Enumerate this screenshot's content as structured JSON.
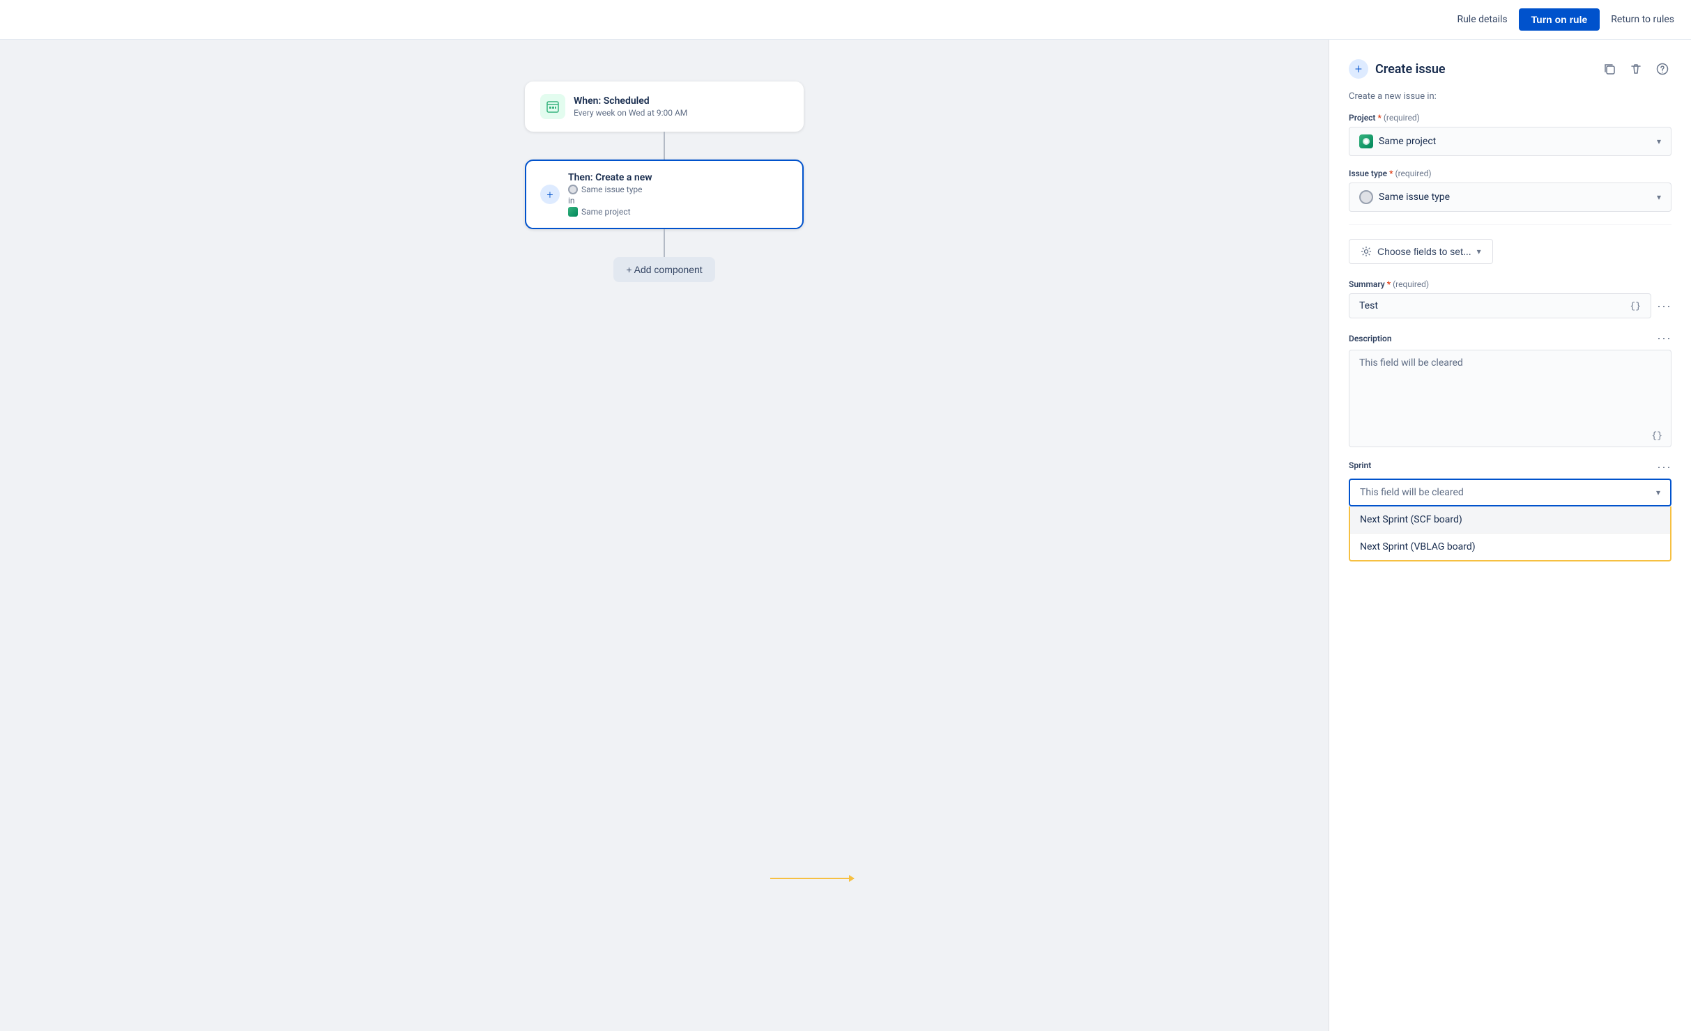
{
  "topNav": {
    "ruleDetailsLabel": "Rule details",
    "turnOnRuleLabel": "Turn on rule",
    "returnToRulesLabel": "Return to rules"
  },
  "canvas": {
    "triggerNode": {
      "title": "When: Scheduled",
      "subtitle": "Every week on Wed at 9:00 AM"
    },
    "actionNode": {
      "title": "Then: Create a new",
      "issueType": "Same issue type",
      "inLabel": "in",
      "project": "Same project"
    },
    "addComponentLabel": "+ Add component"
  },
  "panel": {
    "addIcon": "+",
    "title": "Create issue",
    "subtitle": "Create a new issue in:",
    "projectLabel": "Project",
    "projectRequired": "* (required)",
    "projectValue": "Same project",
    "issueTypeLabel": "Issue type",
    "issueTypeRequired": "* (required)",
    "issueTypeValue": "Same issue type",
    "chooseFieldsLabel": "Choose fields to set...",
    "summaryLabel": "Summary",
    "summaryRequired": "* (required)",
    "summaryValue": "Test",
    "summaryPlaceholder": "Test",
    "descriptionLabel": "Description",
    "descriptionPlaceholder": "This field will be cleared",
    "sprintLabel": "Sprint",
    "sprintPlaceholder": "This field will be cleared",
    "sprintOptions": [
      {
        "label": "Next Sprint (SCF board)",
        "highlighted": true
      },
      {
        "label": "Next Sprint (VBLAG board)",
        "highlighted": false
      }
    ],
    "curlyBraces": "{}",
    "moreActions": "···"
  }
}
